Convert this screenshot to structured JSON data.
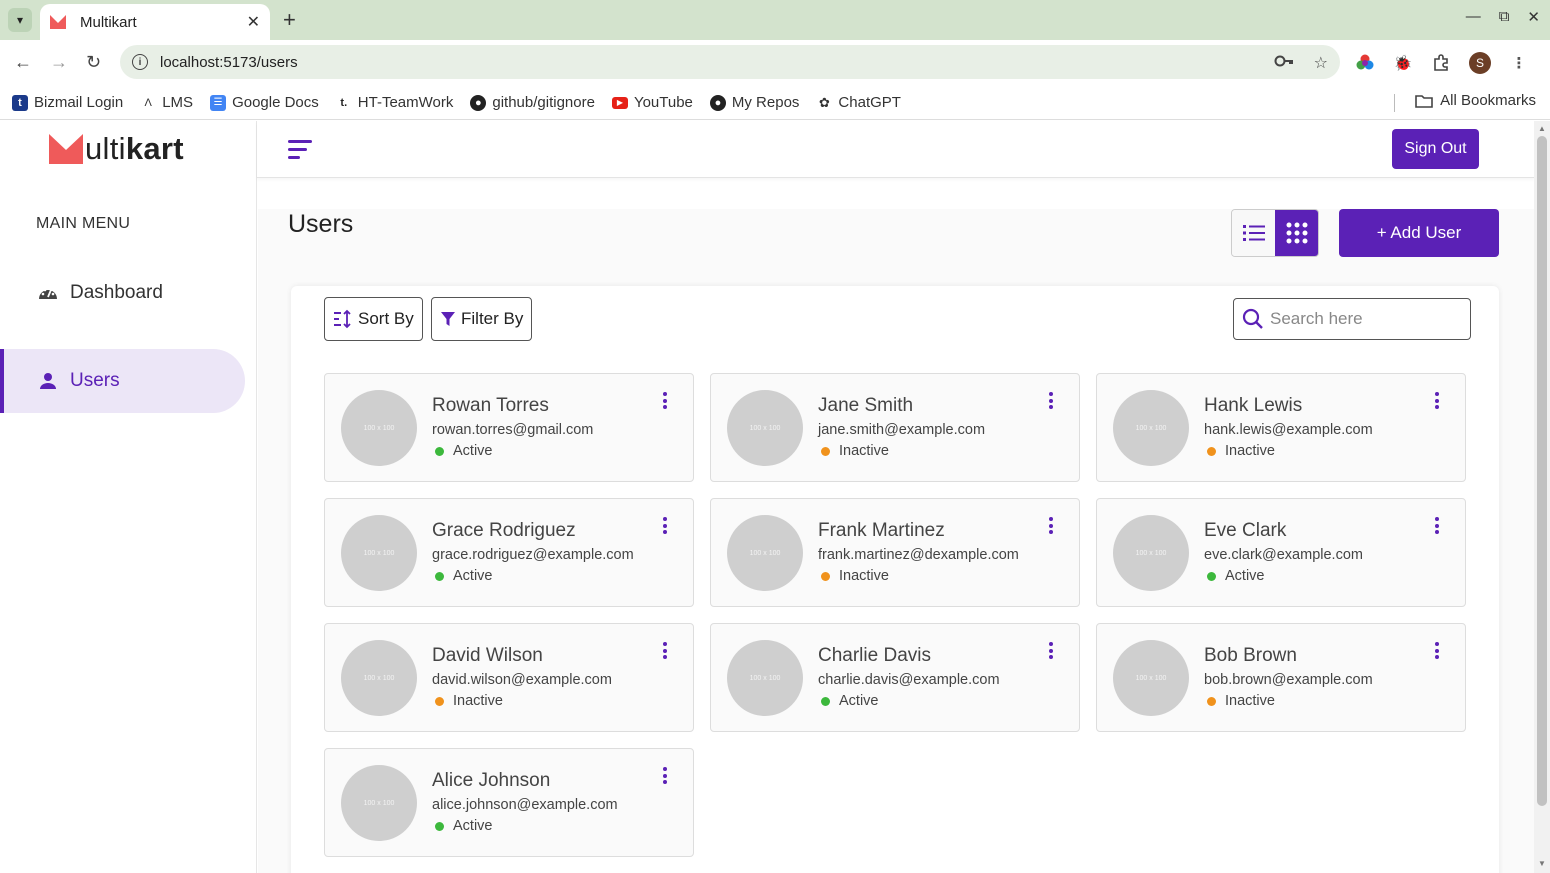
{
  "browser": {
    "tab_title": "Multikart",
    "url": "localhost:5173/users",
    "bookmarks": [
      "Bizmail Login",
      "LMS",
      "Google Docs",
      "HT-TeamWork",
      "github/gitignore",
      "YouTube",
      "My Repos",
      "ChatGPT"
    ],
    "all_bookmarks": "All Bookmarks",
    "profile_initial": "S"
  },
  "brand": {
    "logo_rest": "ulti",
    "logo_bold": "kart",
    "accent": "#5b21b6",
    "logo_color": "#ef5a5a"
  },
  "sidebar": {
    "menu_title": "MAIN MENU",
    "items": [
      {
        "label": "Dashboard",
        "icon": "dashboard-gauge-icon"
      },
      {
        "label": "Users",
        "icon": "user-icon"
      }
    ]
  },
  "header": {
    "sign_out": "Sign Out"
  },
  "page": {
    "title": "Users",
    "add_user": "+ Add User",
    "sort_by": "Sort By",
    "filter_by": "Filter By",
    "search_placeholder": "Search here"
  },
  "status_colors": {
    "Active": "#3cb83c",
    "Inactive": "#f0921c"
  },
  "users": [
    {
      "name": "Rowan Torres",
      "email": "rowan.torres@gmail.com",
      "status": "Active",
      "avatar": "100 x 100"
    },
    {
      "name": "Jane Smith",
      "email": "jane.smith@example.com",
      "status": "Inactive",
      "avatar": "100 x 100"
    },
    {
      "name": "Hank Lewis",
      "email": "hank.lewis@example.com",
      "status": "Inactive",
      "avatar": "100 x 100"
    },
    {
      "name": "Grace Rodriguez",
      "email": "grace.rodriguez@example.com",
      "status": "Active",
      "avatar": "100 x 100"
    },
    {
      "name": "Frank Martinez",
      "email": "frank.martinez@dexample.com",
      "status": "Inactive",
      "avatar": "100 x 100"
    },
    {
      "name": "Eve Clark",
      "email": "eve.clark@example.com",
      "status": "Active",
      "avatar": "100 x 100"
    },
    {
      "name": "David Wilson",
      "email": "david.wilson@example.com",
      "status": "Inactive",
      "avatar": "100 x 100"
    },
    {
      "name": "Charlie Davis",
      "email": "charlie.davis@example.com",
      "status": "Active",
      "avatar": "100 x 100"
    },
    {
      "name": "Bob Brown",
      "email": "bob.brown@example.com",
      "status": "Inactive",
      "avatar": "100 x 100"
    },
    {
      "name": "Alice Johnson",
      "email": "alice.johnson@example.com",
      "status": "Active",
      "avatar": "100 x 100"
    }
  ]
}
